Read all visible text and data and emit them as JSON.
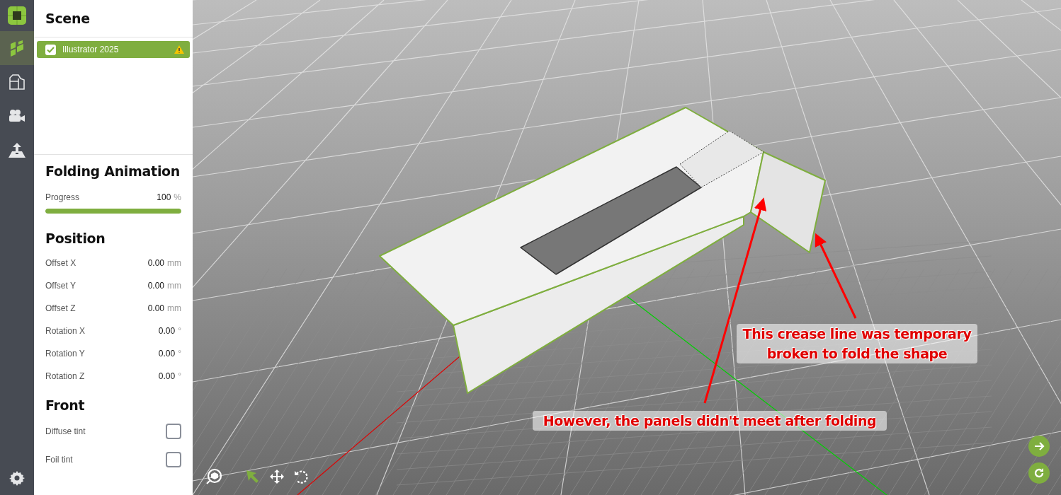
{
  "rail": {
    "items": [
      {
        "kind": "logo",
        "selected": false
      },
      {
        "kind": "scene",
        "selected": true
      },
      {
        "kind": "dieline",
        "selected": false
      },
      {
        "kind": "camera",
        "selected": false
      },
      {
        "kind": "export",
        "selected": false
      },
      {
        "kind": "settings",
        "selected": false
      }
    ]
  },
  "scene": {
    "title": "Scene",
    "layers": [
      {
        "label": "Illustrator 2025",
        "checked": true,
        "selected": true,
        "warning": true
      }
    ]
  },
  "folding_animation": {
    "title": "Folding Animation",
    "progress": {
      "label": "Progress",
      "value": "100",
      "unit": "%",
      "level": 1
    }
  },
  "position": {
    "title": "Position",
    "fields": [
      {
        "label": "Offset X",
        "value": "0.00",
        "unit": "mm"
      },
      {
        "label": "Offset Y",
        "value": "0.00",
        "unit": "mm"
      },
      {
        "label": "Offset Z",
        "value": "0.00",
        "unit": "mm"
      },
      {
        "label": "Rotation X",
        "value": "0.00",
        "unit": "°"
      },
      {
        "label": "Rotation Y",
        "value": "0.00",
        "unit": "°"
      },
      {
        "label": "Rotation Z",
        "value": "0.00",
        "unit": "°"
      }
    ]
  },
  "front": {
    "title": "Front",
    "options": [
      {
        "label": "Diffuse tint",
        "checked": false
      },
      {
        "label": "Foil tint",
        "checked": false
      }
    ]
  },
  "viewport": {
    "annotations": [
      {
        "text": "This crease line was temporary broken to fold the shape"
      },
      {
        "text": "However, the panels didn't meet after folding"
      }
    ],
    "tools": [
      {
        "kind": "view-cube",
        "selected": false
      },
      {
        "kind": "select",
        "selected": true
      },
      {
        "kind": "move",
        "selected": false
      },
      {
        "kind": "rotate",
        "selected": false
      }
    ],
    "actions": [
      {
        "kind": "next"
      },
      {
        "kind": "refresh"
      }
    ]
  }
}
